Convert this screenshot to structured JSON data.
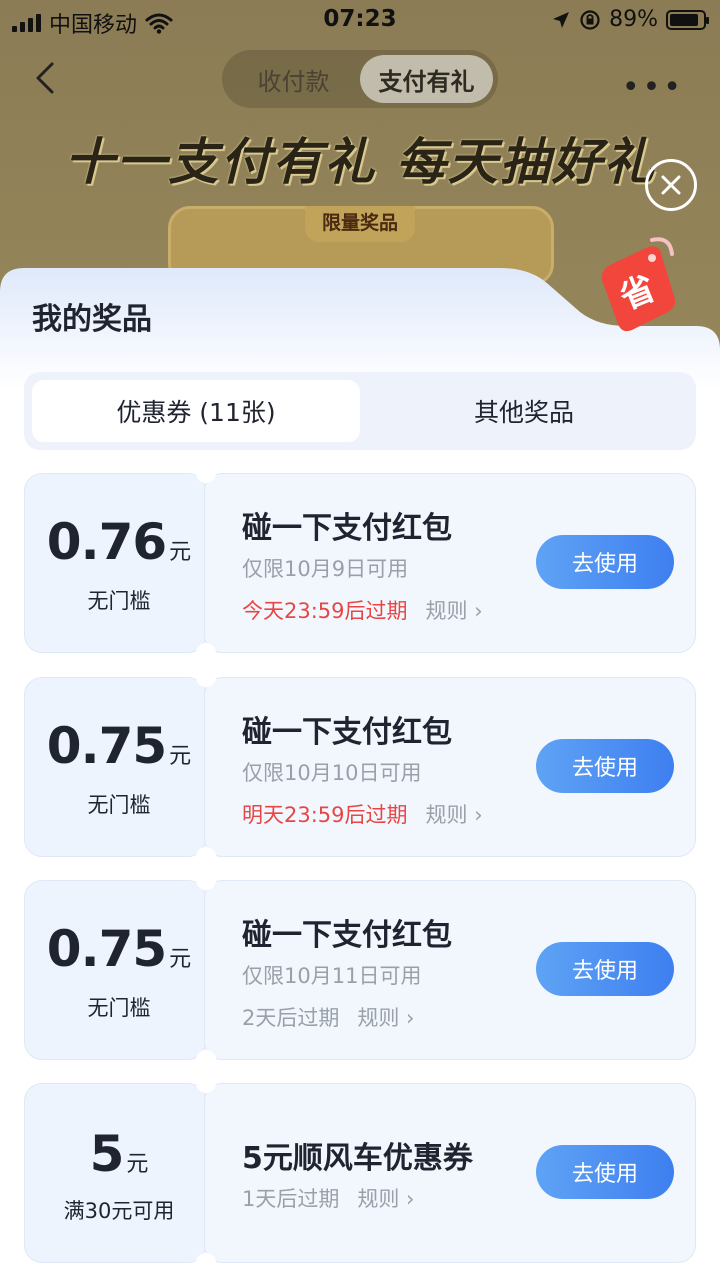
{
  "status_bar": {
    "carrier": "中国移动",
    "time": "07:23",
    "battery": "89%",
    "battery_level": 0.89
  },
  "nav": {
    "tabs": [
      {
        "label": "收付款",
        "active": false
      },
      {
        "label": "支付有礼",
        "active": true
      }
    ],
    "more_label": "•••"
  },
  "promo": {
    "headline": "十一支付有礼  每天抽好礼",
    "prize_tag": "限量奖品"
  },
  "sheet": {
    "title": "我的奖品",
    "badge_char": "省",
    "tabs": [
      {
        "label": "优惠券 (11张)",
        "active": true
      },
      {
        "label": "其他奖品",
        "active": false
      }
    ],
    "coupons": [
      {
        "amount": "0.76",
        "unit": "元",
        "condition": "无门槛",
        "title": "碰一下支付红包",
        "subtitle": "仅限10月9日可用",
        "expiry": "今天23:59后过期",
        "expiry_color": "red",
        "rule": "规则 ›",
        "button": "去使用"
      },
      {
        "amount": "0.75",
        "unit": "元",
        "condition": "无门槛",
        "title": "碰一下支付红包",
        "subtitle": "仅限10月10日可用",
        "expiry": "明天23:59后过期",
        "expiry_color": "red",
        "rule": "规则 ›",
        "button": "去使用"
      },
      {
        "amount": "0.75",
        "unit": "元",
        "condition": "无门槛",
        "title": "碰一下支付红包",
        "subtitle": "仅限10月11日可用",
        "expiry": "2天后过期",
        "expiry_color": "grey",
        "rule": "规则 ›",
        "button": "去使用"
      },
      {
        "amount": "5",
        "unit": "元",
        "condition": "满30元可用",
        "title": "5元顺风车优惠券",
        "subtitle": "",
        "expiry": "1天后过期",
        "expiry_color": "grey",
        "rule": "规则 ›",
        "button": "去使用"
      }
    ]
  },
  "colors": {
    "accent_blue": "#3e7ff0",
    "expiry_red": "#e84545",
    "text_dark": "#1f2430",
    "text_grey": "#9aa0aa"
  }
}
